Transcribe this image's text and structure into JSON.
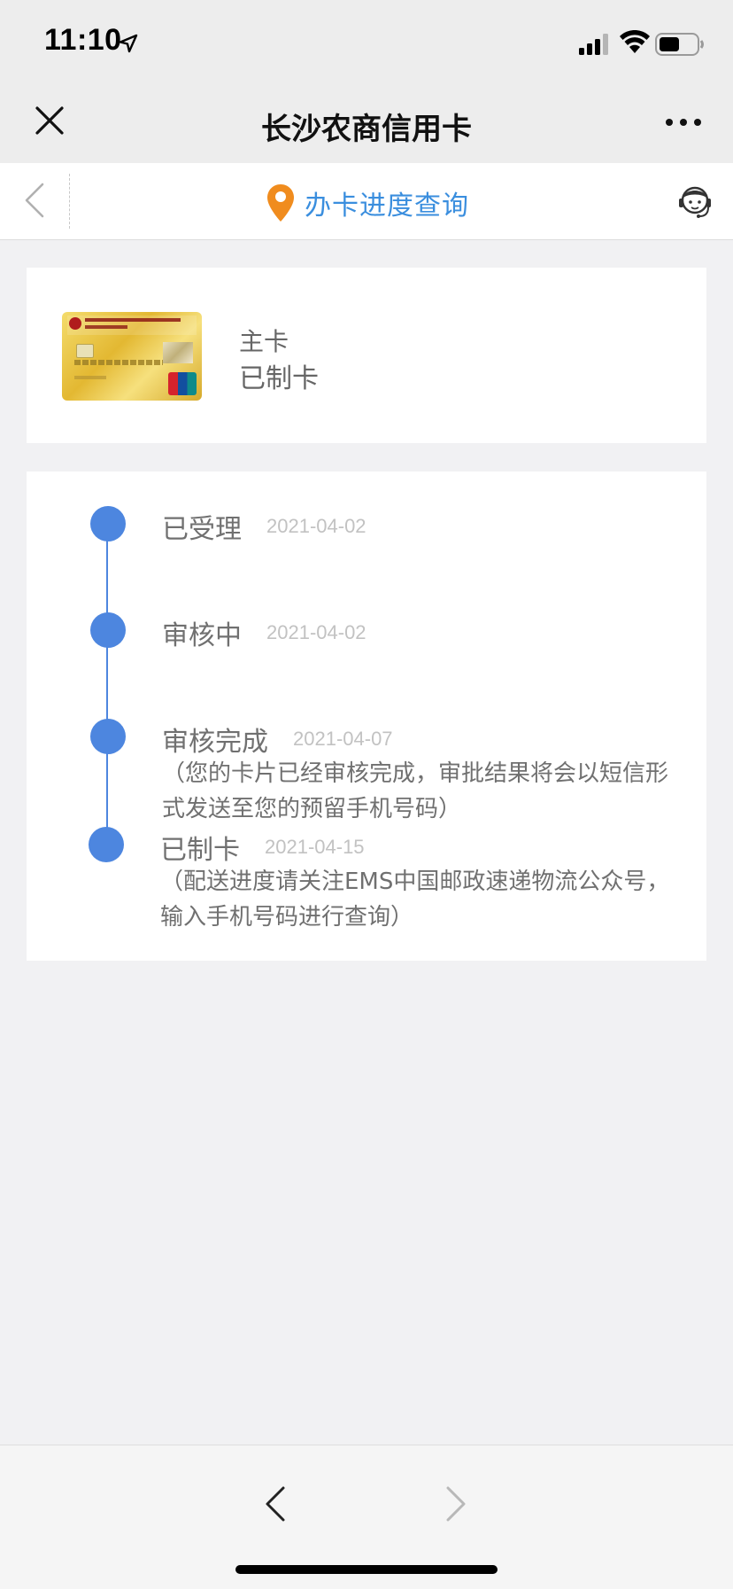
{
  "status_bar": {
    "time": "11:10"
  },
  "nav": {
    "title": "长沙农商信用卡"
  },
  "sub_header": {
    "title": "办卡进度查询"
  },
  "card": {
    "type": "主卡",
    "status": "已制卡"
  },
  "timeline": [
    {
      "label": "已受理",
      "date": "2021-04-02",
      "note": ""
    },
    {
      "label": "审核中",
      "date": "2021-04-02",
      "note": ""
    },
    {
      "label": "审核完成",
      "date": "2021-04-07",
      "note": "（您的卡片已经审核完成，审批结果将会以短信形式发送至您的预留手机号码）"
    },
    {
      "label": "已制卡",
      "date": "2021-04-15",
      "note": "（配送进度请关注EMS中国邮政速递物流公众号，输入手机号码进行查询）"
    }
  ],
  "colors": {
    "accent_blue": "#4d86df",
    "title_blue": "#3a8ede",
    "pin_orange": "#f08c1e"
  }
}
